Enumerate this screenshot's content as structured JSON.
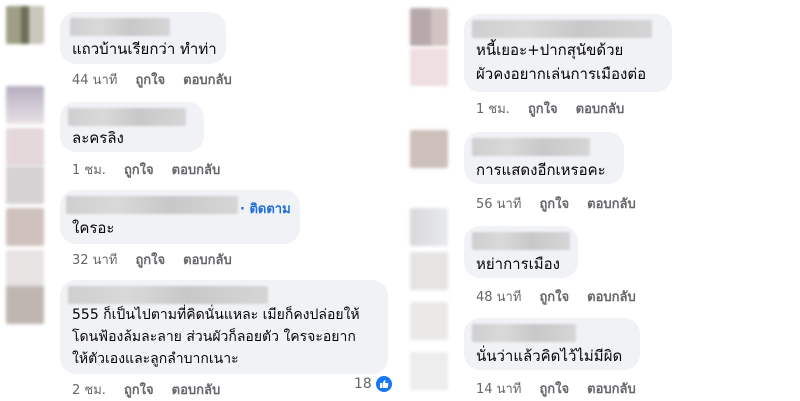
{
  "left_comments": [
    {
      "text": [
        "แถวบ้านเรียกว่า ทำท่า"
      ],
      "time": "44 นาที",
      "like": "ถูกใจ",
      "reply": "ตอบกลับ"
    },
    {
      "text": [
        "ละครลิง"
      ],
      "time": "1 ชม.",
      "like": "ถูกใจ",
      "reply": "ตอบกลับ"
    },
    {
      "follow": "· ติดตาม",
      "text": [
        "ใครอะ"
      ],
      "time": "32 นาที",
      "like": "ถูกใจ",
      "reply": "ตอบกลับ"
    },
    {
      "text": [
        "555 ก็เป็นไปตามที่คิดนั่นแหละ เมียก็คงปล่อยให้",
        "โดนฟ้องล้มละลาย ส่วนผัวก็ลอยตัว ใครจะอยาก",
        "ให้ตัวเองและลูกลำบากเนาะ"
      ],
      "time": "2 ชม.",
      "like": "ถูกใจ",
      "reply": "ตอบกลับ",
      "reaction_count": "18"
    }
  ],
  "right_comments": [
    {
      "text": [
        "หนี้เยอะ+ปากสุนัขด้วย",
        "ผัวคงอยากเล่นการเมืองต่อ"
      ],
      "time": "1 ชม.",
      "like": "ถูกใจ",
      "reply": "ตอบกลับ"
    },
    {
      "text": [
        "การแสดงอีกเหรอคะ"
      ],
      "time": "56 นาที",
      "like": "ถูกใจ",
      "reply": "ตอบกลับ"
    },
    {
      "text": [
        "หย่าการเมือง"
      ],
      "time": "48 นาที",
      "like": "ถูกใจ",
      "reply": "ตอบกลับ"
    },
    {
      "text": [
        "นั่นว่าแล้วคิดไว้ไม่มีผิด"
      ],
      "time": "14 นาที",
      "like": "ถูกใจ",
      "reply": "ตอบกลับ"
    }
  ],
  "icons": {
    "like_reaction": "thumbs-up-icon"
  },
  "colors": {
    "bubble": "#f0f2f5",
    "link_blue": "#216fdb",
    "meta_gray": "#65676b",
    "like_blue": "#1877f2"
  }
}
